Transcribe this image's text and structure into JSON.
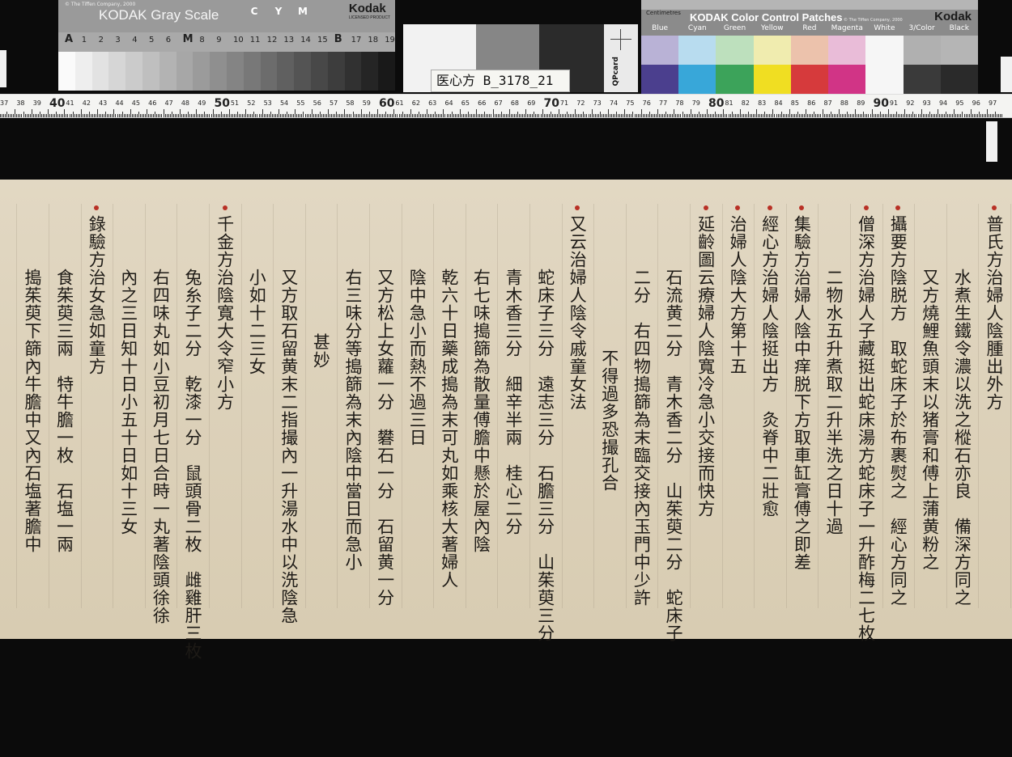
{
  "gray_card": {
    "copyright": "© The Tiffen Company, 2000",
    "title": "KODAK Gray Scale",
    "brand": "Kodak",
    "brand_sub": "LICENSED PRODUCT",
    "cym": [
      "C",
      "Y",
      "M"
    ],
    "cym_colors": [
      "#2ba8e0",
      "#f3d21a",
      "#d6337c"
    ],
    "scale_labels": [
      "A",
      "1",
      "2",
      "3",
      "4",
      "5",
      "6",
      "M",
      "8",
      "9",
      "10",
      "11",
      "12",
      "13",
      "14",
      "15",
      "B",
      "17",
      "18",
      "19"
    ]
  },
  "label_card": {
    "text": "医心方 B_3178_21"
  },
  "qp_card": {
    "text": "QPcard"
  },
  "color_card": {
    "centimetres": "Centimetres",
    "title": "KODAK Color Control Patches",
    "copyright": "© The Tiffen Company, 2000",
    "brand": "Kodak",
    "patch_names": [
      "Blue",
      "Cyan",
      "Green",
      "Yellow",
      "Red",
      "Magenta",
      "White",
      "3/Color",
      "Black"
    ],
    "row1_colors": [
      "#b9b2d6",
      "#b8dcef",
      "#bde0bd",
      "#f0ecaf",
      "#ecc2ac",
      "#e9bcd8",
      "#f6f6f6",
      "#b0b0b0",
      "#b5b5b5"
    ],
    "row2_colors": [
      "#4b3f8e",
      "#38a7d9",
      "#3ca35a",
      "#f0de22",
      "#d63a3c",
      "#d13486",
      "#f6f6f6",
      "#3a3a3a",
      "#2a2a2a"
    ]
  },
  "ruler": {
    "labels": [
      "37",
      "38",
      "39",
      "40",
      "41",
      "42",
      "43",
      "44",
      "45",
      "46",
      "47",
      "48",
      "49",
      "50",
      "51",
      "52",
      "53",
      "54",
      "55",
      "56",
      "57",
      "58",
      "59",
      "60",
      "61",
      "62",
      "63",
      "64",
      "65",
      "66",
      "67",
      "68",
      "69",
      "70",
      "71",
      "72",
      "73",
      "74",
      "75",
      "76",
      "77",
      "78",
      "79",
      "80",
      "81",
      "82",
      "83",
      "84",
      "85",
      "86",
      "87",
      "88",
      "89",
      "90",
      "91",
      "92",
      "93",
      "94",
      "95",
      "96",
      "97"
    ]
  },
  "document": {
    "columns": [
      "普氏方治婦人陰腫出外方",
      "水煮生鐵令濃以洗之樅石亦良　備深方同之",
      "又方燒鯉魚頭末以猪膏和傅上蒲黄粉之",
      "攝要方陰脱方　取蛇床子於布裹熨之　經心方同之",
      "僧深方治婦人子藏挺出蛇床湯方蛇床子一升酢梅二七枚",
      "二物水五升煮取二升半洗之日十過",
      "集驗方治婦人陰中痒脱下方取車缸膏傅之即差",
      "經心方治婦人陰挺出方　灸脊中二壯愈",
      "治婦人陰大方第十五",
      "延齡圖云療婦人陰寬冷急小交接而快方",
      "石流黄二分　青木香二分　山茱萸二分　蛇床子",
      "二分　右四物搗篩為末臨交接內玉門中少許",
      "不得過多恐撮孔合",
      "又云治婦人陰令戚童女法",
      "蛇床子三分　遠志三分　石膽三分　山茱萸三分",
      "青木香三分　細辛半兩　桂心二分",
      "右七味搗篩為散量傅膽中懸於屋內陰",
      "乾六十日藥成搗為末可丸如乘核大著婦人",
      "陰中急小而熱不過三日",
      "又方松上女蘿一分　礬石一分　石留黄一分",
      "右三味分等搗篩為末內陰中當日而急小",
      "甚妙",
      "又方取石留黄末二指撮內一升湯水中以洗陰急",
      "小如十二三女",
      "千金方治陰寬大令窄小方",
      "兔糸子二分　乾漆一分　鼠頭骨二枚　雌雞肝三枚",
      "右四味丸如小豆初月七日合時一丸著陰頭徐徐",
      "內之三日知十日小五十日如十三女",
      "錄驗方治女急如童方",
      "食茱萸三兩　特牛膽一枚　石塩一兩",
      "搗茱萸下篩內牛膽中又內石塩著膽中"
    ]
  }
}
